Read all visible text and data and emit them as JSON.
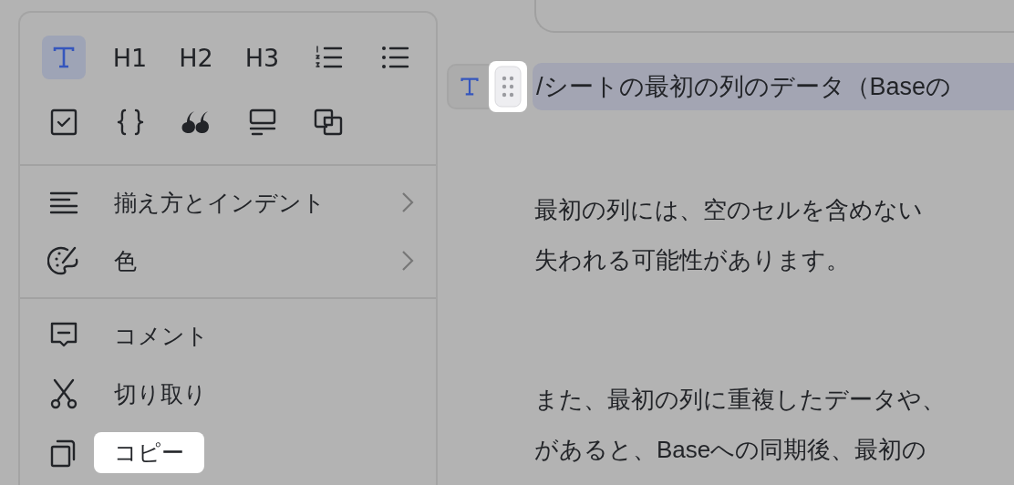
{
  "format_menu": {
    "block_types": [
      {
        "kind": "text",
        "selected": true
      },
      {
        "kind": "heading",
        "label": "H1",
        "selected": false
      },
      {
        "kind": "heading",
        "label": "H2",
        "selected": false
      },
      {
        "kind": "heading",
        "label": "H3",
        "selected": false
      },
      {
        "kind": "numbered-list",
        "selected": false
      },
      {
        "kind": "bullet-list",
        "selected": false
      },
      {
        "kind": "todo",
        "selected": false
      },
      {
        "kind": "code",
        "selected": false
      },
      {
        "kind": "quote",
        "selected": false
      },
      {
        "kind": "callout",
        "selected": false
      },
      {
        "kind": "sync",
        "selected": false
      }
    ],
    "groups": [
      [
        {
          "kind": "align",
          "label": "揃え方とインデント",
          "submenu": true,
          "highlighted": false
        },
        {
          "kind": "color",
          "label": "色",
          "submenu": true,
          "highlighted": false
        }
      ],
      [
        {
          "kind": "comment",
          "label": "コメント",
          "submenu": false,
          "highlighted": false
        },
        {
          "kind": "cut",
          "label": "切り取り",
          "submenu": false,
          "highlighted": false
        },
        {
          "kind": "copy",
          "label": "コピー",
          "submenu": false,
          "highlighted": true
        }
      ]
    ]
  },
  "document": {
    "current_block": {
      "handle_highlighted": true,
      "text": "/シートの最初の列のデータ（Baseの"
    },
    "paragraphs": [
      {
        "lines": [
          "最初の列には、空のセルを含めない",
          "失われる可能性があります。"
        ]
      },
      {
        "lines": [
          "また、最初の列に重複したデータや、",
          "があると、Baseへの同期後、最初の"
        ]
      }
    ]
  }
}
